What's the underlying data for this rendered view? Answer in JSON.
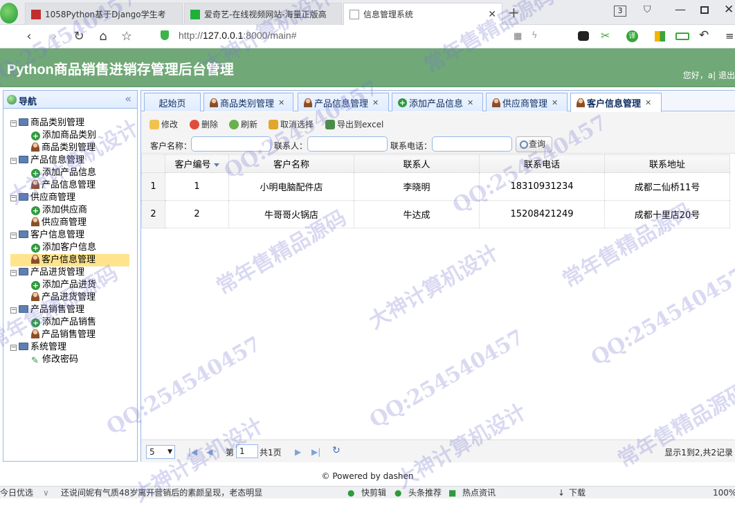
{
  "browser": {
    "tabs": [
      {
        "title": "1058Python基于Django学生考"
      },
      {
        "title": "爱奇艺-在线视频网站-海量正版高"
      },
      {
        "title": "信息管理系统"
      }
    ],
    "url_prefix": "http://",
    "url_host": "127.0.0.1",
    "url_rest": ":8000/main#",
    "tab_count": "3"
  },
  "app": {
    "title": "Python商品销售进销存管理后台管理",
    "welcome": "您好，a| 退出"
  },
  "nav": {
    "title": "导航",
    "groups": [
      {
        "label": "商品类别管理",
        "items": [
          "添加商品类别",
          "商品类别管理"
        ]
      },
      {
        "label": "产品信息管理",
        "items": [
          "添加产品信息",
          "产品信息管理"
        ]
      },
      {
        "label": "供应商管理",
        "items": [
          "添加供应商",
          "供应商管理"
        ]
      },
      {
        "label": "客户信息管理",
        "items": [
          "添加客户信息",
          "客户信息管理"
        ]
      },
      {
        "label": "产品进货管理",
        "items": [
          "添加产品进货",
          "产品进货管理"
        ]
      },
      {
        "label": "产品销售管理",
        "items": [
          "添加产品销售",
          "产品销售管理"
        ]
      },
      {
        "label": "系统管理",
        "items": [
          "修改密码"
        ]
      }
    ],
    "selected": "客户信息管理"
  },
  "tabs": [
    {
      "label": "起始页"
    },
    {
      "label": "商品类别管理"
    },
    {
      "label": "产品信息管理"
    },
    {
      "label": "添加产品信息"
    },
    {
      "label": "供应商管理"
    },
    {
      "label": "客户信息管理"
    }
  ],
  "toolbar": {
    "edit": "修改",
    "delete": "删除",
    "refresh": "刷新",
    "cancel": "取消选择",
    "export": "导出到excel",
    "search_customer_label": "客户名称：",
    "search_contact_label": "联系人：",
    "search_phone_label": "联系电话：",
    "query": "查询"
  },
  "grid": {
    "columns": [
      "客户编号",
      "客户名称",
      "联系人",
      "联系电话",
      "联系地址"
    ],
    "rows": [
      {
        "rownum": "1",
        "id": "1",
        "name": "小明电脑配件店",
        "contact": "李晓明",
        "phone": "18310931234",
        "address": "成都二仙桥11号"
      },
      {
        "rownum": "2",
        "id": "2",
        "name": "牛哥哥火锅店",
        "contact": "牛达成",
        "phone": "15208421249",
        "address": "成都十里店20号"
      }
    ]
  },
  "pager": {
    "page_size": "5",
    "page_prefix": "第",
    "page": "1",
    "page_total": "共1页",
    "info": "显示1到2,共2记录"
  },
  "footer": "© Powered by dashen",
  "statusbar": {
    "left": "今日优选",
    "news": "还说间妮有气质48岁离开营销后的素颜呈现，老态明显",
    "clip": "快剪辑",
    "headline": "头条推荐",
    "hot": "热点资讯",
    "download": "下载",
    "zoom": "100%"
  },
  "watermarks": [
    "QQ:254540457",
    "大神计算机设计",
    "常年售精品源码"
  ]
}
